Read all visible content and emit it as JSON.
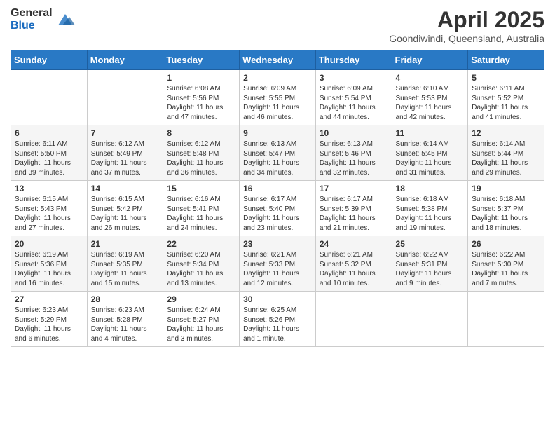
{
  "header": {
    "logo_general": "General",
    "logo_blue": "Blue",
    "month_title": "April 2025",
    "location": "Goondiwindi, Queensland, Australia"
  },
  "days_of_week": [
    "Sunday",
    "Monday",
    "Tuesday",
    "Wednesday",
    "Thursday",
    "Friday",
    "Saturday"
  ],
  "weeks": [
    [
      {
        "day": "",
        "info": ""
      },
      {
        "day": "",
        "info": ""
      },
      {
        "day": "1",
        "info": "Sunrise: 6:08 AM\nSunset: 5:56 PM\nDaylight: 11 hours and 47 minutes."
      },
      {
        "day": "2",
        "info": "Sunrise: 6:09 AM\nSunset: 5:55 PM\nDaylight: 11 hours and 46 minutes."
      },
      {
        "day": "3",
        "info": "Sunrise: 6:09 AM\nSunset: 5:54 PM\nDaylight: 11 hours and 44 minutes."
      },
      {
        "day": "4",
        "info": "Sunrise: 6:10 AM\nSunset: 5:53 PM\nDaylight: 11 hours and 42 minutes."
      },
      {
        "day": "5",
        "info": "Sunrise: 6:11 AM\nSunset: 5:52 PM\nDaylight: 11 hours and 41 minutes."
      }
    ],
    [
      {
        "day": "6",
        "info": "Sunrise: 6:11 AM\nSunset: 5:50 PM\nDaylight: 11 hours and 39 minutes."
      },
      {
        "day": "7",
        "info": "Sunrise: 6:12 AM\nSunset: 5:49 PM\nDaylight: 11 hours and 37 minutes."
      },
      {
        "day": "8",
        "info": "Sunrise: 6:12 AM\nSunset: 5:48 PM\nDaylight: 11 hours and 36 minutes."
      },
      {
        "day": "9",
        "info": "Sunrise: 6:13 AM\nSunset: 5:47 PM\nDaylight: 11 hours and 34 minutes."
      },
      {
        "day": "10",
        "info": "Sunrise: 6:13 AM\nSunset: 5:46 PM\nDaylight: 11 hours and 32 minutes."
      },
      {
        "day": "11",
        "info": "Sunrise: 6:14 AM\nSunset: 5:45 PM\nDaylight: 11 hours and 31 minutes."
      },
      {
        "day": "12",
        "info": "Sunrise: 6:14 AM\nSunset: 5:44 PM\nDaylight: 11 hours and 29 minutes."
      }
    ],
    [
      {
        "day": "13",
        "info": "Sunrise: 6:15 AM\nSunset: 5:43 PM\nDaylight: 11 hours and 27 minutes."
      },
      {
        "day": "14",
        "info": "Sunrise: 6:15 AM\nSunset: 5:42 PM\nDaylight: 11 hours and 26 minutes."
      },
      {
        "day": "15",
        "info": "Sunrise: 6:16 AM\nSunset: 5:41 PM\nDaylight: 11 hours and 24 minutes."
      },
      {
        "day": "16",
        "info": "Sunrise: 6:17 AM\nSunset: 5:40 PM\nDaylight: 11 hours and 23 minutes."
      },
      {
        "day": "17",
        "info": "Sunrise: 6:17 AM\nSunset: 5:39 PM\nDaylight: 11 hours and 21 minutes."
      },
      {
        "day": "18",
        "info": "Sunrise: 6:18 AM\nSunset: 5:38 PM\nDaylight: 11 hours and 19 minutes."
      },
      {
        "day": "19",
        "info": "Sunrise: 6:18 AM\nSunset: 5:37 PM\nDaylight: 11 hours and 18 minutes."
      }
    ],
    [
      {
        "day": "20",
        "info": "Sunrise: 6:19 AM\nSunset: 5:36 PM\nDaylight: 11 hours and 16 minutes."
      },
      {
        "day": "21",
        "info": "Sunrise: 6:19 AM\nSunset: 5:35 PM\nDaylight: 11 hours and 15 minutes."
      },
      {
        "day": "22",
        "info": "Sunrise: 6:20 AM\nSunset: 5:34 PM\nDaylight: 11 hours and 13 minutes."
      },
      {
        "day": "23",
        "info": "Sunrise: 6:21 AM\nSunset: 5:33 PM\nDaylight: 11 hours and 12 minutes."
      },
      {
        "day": "24",
        "info": "Sunrise: 6:21 AM\nSunset: 5:32 PM\nDaylight: 11 hours and 10 minutes."
      },
      {
        "day": "25",
        "info": "Sunrise: 6:22 AM\nSunset: 5:31 PM\nDaylight: 11 hours and 9 minutes."
      },
      {
        "day": "26",
        "info": "Sunrise: 6:22 AM\nSunset: 5:30 PM\nDaylight: 11 hours and 7 minutes."
      }
    ],
    [
      {
        "day": "27",
        "info": "Sunrise: 6:23 AM\nSunset: 5:29 PM\nDaylight: 11 hours and 6 minutes."
      },
      {
        "day": "28",
        "info": "Sunrise: 6:23 AM\nSunset: 5:28 PM\nDaylight: 11 hours and 4 minutes."
      },
      {
        "day": "29",
        "info": "Sunrise: 6:24 AM\nSunset: 5:27 PM\nDaylight: 11 hours and 3 minutes."
      },
      {
        "day": "30",
        "info": "Sunrise: 6:25 AM\nSunset: 5:26 PM\nDaylight: 11 hours and 1 minute."
      },
      {
        "day": "",
        "info": ""
      },
      {
        "day": "",
        "info": ""
      },
      {
        "day": "",
        "info": ""
      }
    ]
  ]
}
